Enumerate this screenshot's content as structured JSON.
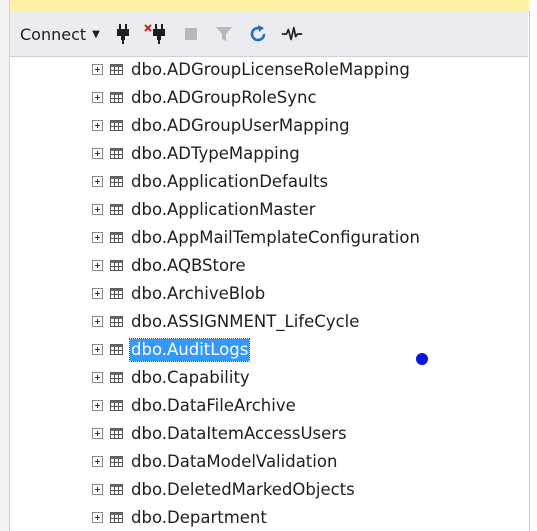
{
  "toolbar": {
    "connect_label": "Connect",
    "icons": [
      "connect-plug-icon",
      "disconnect-icon",
      "stop-icon",
      "filter-icon",
      "refresh-icon",
      "activity-monitor-icon"
    ]
  },
  "tree": {
    "items": [
      {
        "label": "dbo.ADGroupLicenseRoleMapping",
        "selected": false
      },
      {
        "label": "dbo.ADGroupRoleSync",
        "selected": false
      },
      {
        "label": "dbo.ADGroupUserMapping",
        "selected": false
      },
      {
        "label": "dbo.ADTypeMapping",
        "selected": false
      },
      {
        "label": "dbo.ApplicationDefaults",
        "selected": false
      },
      {
        "label": "dbo.ApplicationMaster",
        "selected": false
      },
      {
        "label": "dbo.AppMailTemplateConfiguration",
        "selected": false
      },
      {
        "label": "dbo.AQBStore",
        "selected": false
      },
      {
        "label": "dbo.ArchiveBlob",
        "selected": false
      },
      {
        "label": "dbo.ASSIGNMENT_LifeCycle",
        "selected": false
      },
      {
        "label": "dbo.AuditLogs",
        "selected": true
      },
      {
        "label": "dbo.Capability",
        "selected": false
      },
      {
        "label": "dbo.DataFileArchive",
        "selected": false
      },
      {
        "label": "dbo.DataItemAccessUsers",
        "selected": false
      },
      {
        "label": "dbo.DataModelValidation",
        "selected": false
      },
      {
        "label": "dbo.DeletedMarkedObjects",
        "selected": false
      },
      {
        "label": "dbo.Department",
        "selected": false
      }
    ]
  },
  "colors": {
    "selection": "#3399ff",
    "toolbar_bg": "#ececf0",
    "refresh_blue": "#1e6fc8",
    "disconnect_red": "#c42b1c",
    "cursor_dot": "#0a14e6"
  }
}
